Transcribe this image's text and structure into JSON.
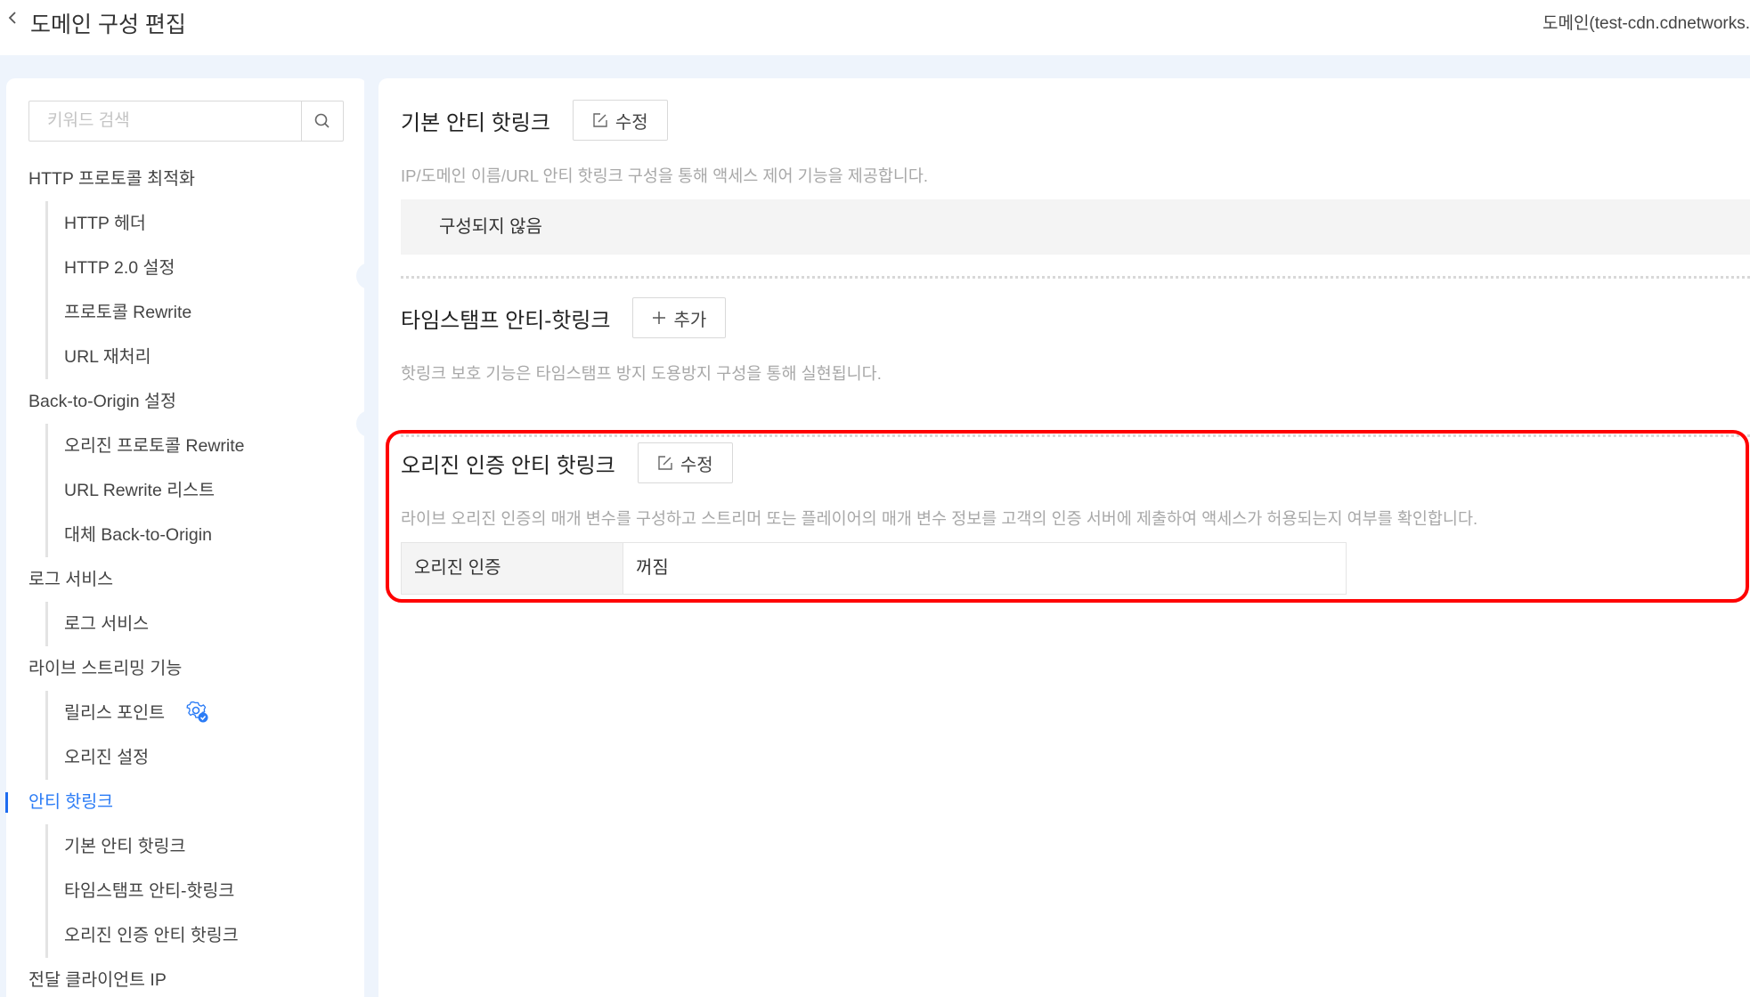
{
  "header": {
    "back_icon": "chevron-left-icon",
    "title": "도메인 구성 편집",
    "domain_label": "도메인(test-cdn.cdnetworks."
  },
  "sidebar": {
    "search": {
      "placeholder": "키워드 검색",
      "value": "",
      "icon": "search-icon"
    },
    "groups": [
      {
        "label": "HTTP 프로토콜 최적화",
        "items": [
          "HTTP 헤더",
          "HTTP 2.0 설정",
          "프로토콜 Rewrite",
          "URL 재처리"
        ]
      },
      {
        "label": "Back-to-Origin 설정",
        "items": [
          "오리진 프로토콜 Rewrite",
          "URL Rewrite 리스트",
          "대체 Back-to-Origin"
        ]
      },
      {
        "label": "로그 서비스",
        "items": [
          "로그 서비스"
        ]
      },
      {
        "label": "라이브 스트리밍 기능",
        "items": [
          "릴리스 포인트",
          "오리진 설정"
        ],
        "badge_icon": "gear-check-icon"
      },
      {
        "label": "안티 핫링크",
        "active": true,
        "items": [
          "기본 안티 핫링크",
          "타임스탬프 안티-핫링크",
          "오리진 인증 안티 핫링크"
        ]
      },
      {
        "label": "전달 클라이언트 IP",
        "items": []
      }
    ]
  },
  "sections": {
    "basic": {
      "title": "기본 안티 핫링크",
      "button_label": "수정",
      "button_icon": "edit-icon",
      "description": "IP/도메인 이름/URL 안티 핫링크 구성을 통해 액세스 제어 기능을 제공합니다.",
      "status": "구성되지 않음"
    },
    "timestamp": {
      "title": "타임스탬프 안티-핫링크",
      "button_label": "추가",
      "button_icon": "plus-icon",
      "description": "핫링크 보호 기능은 타임스탬프 방지 도용방지 구성을 통해 실현됩니다."
    },
    "origin_auth": {
      "title": "오리진 인증 안티 핫링크",
      "button_label": "수정",
      "button_icon": "edit-icon",
      "description": "라이브 오리진 인증의 매개 변수를 구성하고 스트리머 또는 플레이어의 매개 변수 정보를 고객의 인증 서버에 제출하여 액세스가 허용되는지 여부를 확인합니다.",
      "field_label": "오리진 인증",
      "field_value": "꺼짐"
    }
  },
  "colors": {
    "accent": "#2b7cf6",
    "highlight": "#ff0000",
    "band": "#eef4fc"
  }
}
